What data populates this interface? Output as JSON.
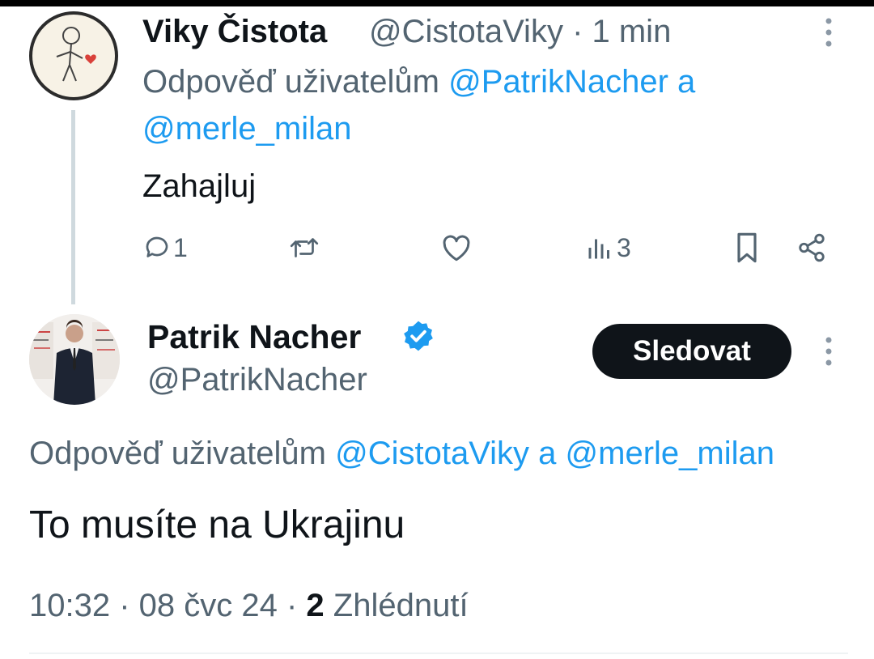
{
  "tweet1": {
    "author_name": "Viky Čistota",
    "author_handle": "@CistotaViky",
    "time_sep": " · ",
    "time": "1 min",
    "reply_prefix": "Odpověď uživatelům ",
    "reply_to_1": "@PatrikNacher",
    "reply_conj": " a ",
    "reply_to_2": "@merle_milan",
    "text": "Zahajluj",
    "reply_count": "1",
    "views": "3"
  },
  "tweet2": {
    "author_name": "Patrik Nacher",
    "author_handle": "@PatrikNacher",
    "follow_label": "Sledovat",
    "reply_prefix": "Odpověď uživatelům ",
    "reply_to_1": "@CistotaViky",
    "reply_conj": " a ",
    "reply_to_2": "@merle_milan",
    "text": "To musíte na Ukrajinu",
    "time": "10:32",
    "sep": " · ",
    "date": "08 čvc 24",
    "views_count": "2",
    "views_label": " Zhlédnutí"
  },
  "icons": [
    "more-vertical-icon",
    "reply-icon",
    "retweet-icon",
    "like-icon",
    "views-icon",
    "bookmark-icon",
    "share-icon",
    "verified-badge-icon"
  ],
  "colors": {
    "accent": "#1d9bf0",
    "text": "#0f1419",
    "secondary": "#536471",
    "button": "#0f1419"
  }
}
